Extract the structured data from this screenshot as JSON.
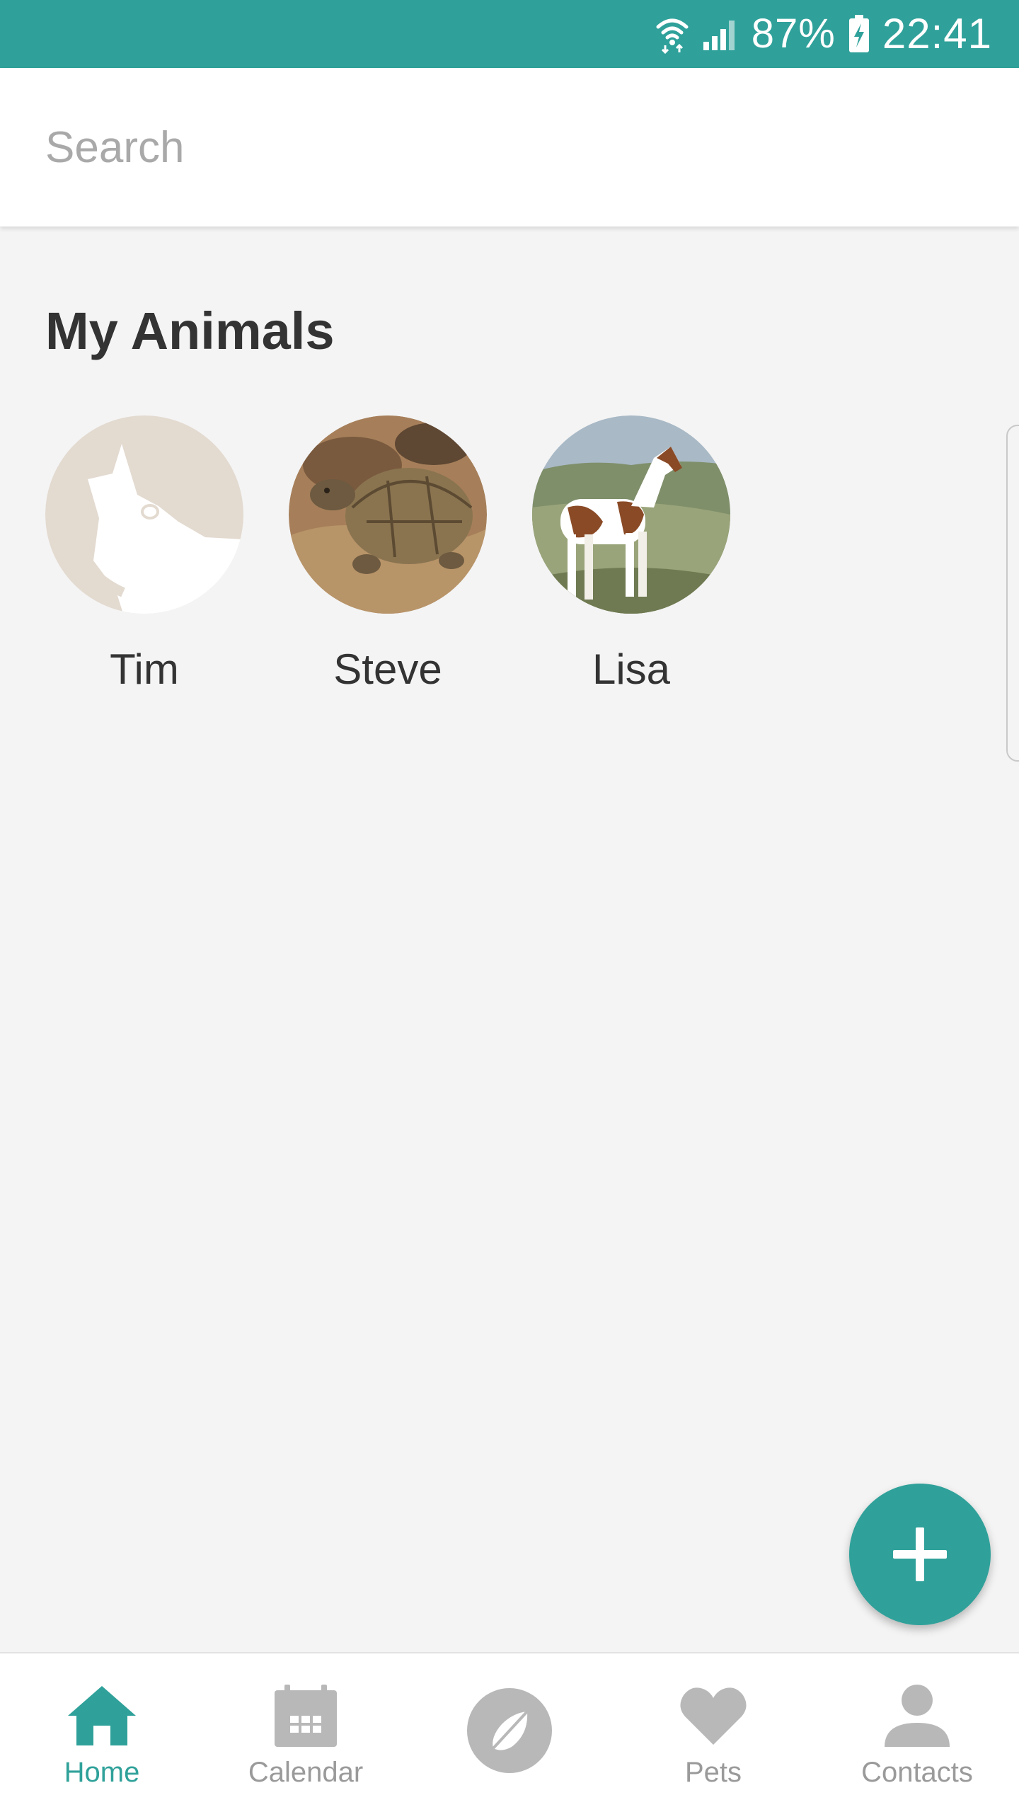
{
  "status_bar": {
    "battery": "87%",
    "time": "22:41",
    "color": "#2fa19a",
    "icons": [
      "wifi-icon",
      "signal-icon",
      "battery-charging-icon"
    ]
  },
  "search": {
    "placeholder": "Search",
    "value": ""
  },
  "section": {
    "title": "My Animals"
  },
  "animals": [
    {
      "name": "Tim",
      "avatar": "dog-placeholder"
    },
    {
      "name": "Steve",
      "avatar": "tortoise-photo"
    },
    {
      "name": "Lisa",
      "avatar": "horse-photo"
    }
  ],
  "fab": {
    "icon": "plus-icon"
  },
  "bottom_nav": {
    "active": "Home",
    "accent": "#2fa19a",
    "inactive_color": "#9a9a9a",
    "items": [
      {
        "label": "Home",
        "icon": "home-icon"
      },
      {
        "label": "Calendar",
        "icon": "calendar-icon"
      },
      {
        "label": "",
        "icon": "compass-icon"
      },
      {
        "label": "Pets",
        "icon": "heart-icon"
      },
      {
        "label": "Contacts",
        "icon": "person-icon"
      }
    ]
  }
}
